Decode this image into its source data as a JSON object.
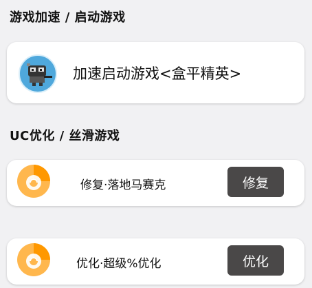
{
  "sections": {
    "accelerate_title": "游戏加速 / 启动游戏",
    "optimize_title": "UC优化 / 丝滑游戏"
  },
  "game_card": {
    "label": "加速启动游戏<盒平精英>",
    "icon": "game-avatar-icon"
  },
  "fix_row": {
    "label": "修复·落地马赛克",
    "button_label": "修复",
    "icon": "uc-browser-icon"
  },
  "optimize_row": {
    "label": "优化·超级%优化",
    "button_label": "优化",
    "icon": "uc-browser-icon"
  },
  "colors": {
    "page_bg": "#f1f1f3",
    "button_bg": "#4a4848",
    "icon_orange": "#ffa726",
    "icon_blue": "#4fa8dc"
  }
}
